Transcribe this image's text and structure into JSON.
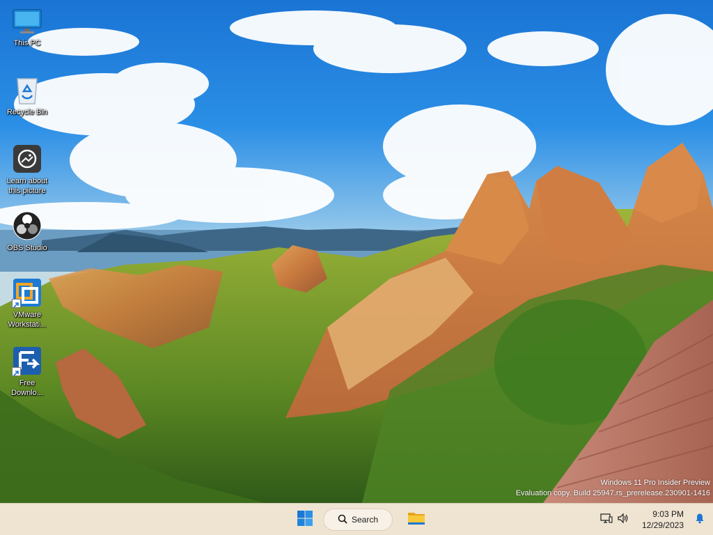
{
  "desktop": {
    "icons": [
      {
        "label": "This PC",
        "icon": "monitor-icon",
        "shortcut": false
      },
      {
        "label": "Recycle Bin",
        "icon": "recycle-bin-icon",
        "shortcut": false
      },
      {
        "label": "Learn about this picture",
        "icon": "camera-icon",
        "shortcut": false
      },
      {
        "label": "OBS Studio",
        "icon": "obs-icon",
        "shortcut": false
      },
      {
        "label": "VMware Workstati...",
        "icon": "vmware-icon",
        "shortcut": true
      },
      {
        "label": "Free Downlo...",
        "icon": "free-download-manager-icon",
        "shortcut": true
      }
    ],
    "wallpaper": "mountain-landscape-image"
  },
  "watermark": {
    "line1": "Windows 11 Pro Insider Preview",
    "line2": "Evaluation copy. Build 25947.rs_prerelease.230901-1416"
  },
  "taskbar": {
    "start_icon": "windows-logo-icon",
    "search_label": "Search",
    "search_icon": "search-icon",
    "explorer_icon": "file-explorer-icon",
    "tray": {
      "icons": [
        "device-icon",
        "volume-icon"
      ],
      "time": "9:03 PM",
      "date": "12/29/2023",
      "notification_icon": "bell-icon"
    }
  },
  "colors": {
    "taskbar_bg": "#efe4d2",
    "accent": "#1a78d4",
    "sky": "#2a8ee6"
  }
}
